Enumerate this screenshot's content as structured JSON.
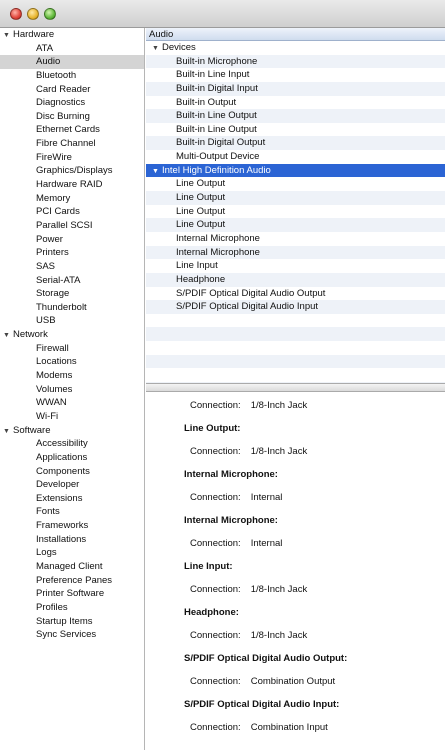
{
  "sidebar": {
    "groups": [
      {
        "label": "Hardware",
        "items": [
          "ATA",
          "Audio",
          "Bluetooth",
          "Card Reader",
          "Diagnostics",
          "Disc Burning",
          "Ethernet Cards",
          "Fibre Channel",
          "FireWire",
          "Graphics/Displays",
          "Hardware RAID",
          "Memory",
          "PCI Cards",
          "Parallel SCSI",
          "Power",
          "Printers",
          "SAS",
          "Serial-ATA",
          "Storage",
          "Thunderbolt",
          "USB"
        ]
      },
      {
        "label": "Network",
        "items": [
          "Firewall",
          "Locations",
          "Modems",
          "Volumes",
          "WWAN",
          "Wi-Fi"
        ]
      },
      {
        "label": "Software",
        "items": [
          "Accessibility",
          "Applications",
          "Components",
          "Developer",
          "Extensions",
          "Fonts",
          "Frameworks",
          "Installations",
          "Logs",
          "Managed Client",
          "Preference Panes",
          "Printer Software",
          "Profiles",
          "Startup Items",
          "Sync Services"
        ]
      }
    ],
    "selected": "Audio"
  },
  "list": {
    "header": "Audio",
    "groups": [
      {
        "label": "Devices",
        "items": [
          "Built-in Microphone",
          "Built-in Line Input",
          "Built-in Digital Input",
          "Built-in Output",
          "Built-in Line Output",
          "Built-in Line Output",
          "Built-in Digital Output",
          "Multi-Output Device"
        ]
      },
      {
        "label": "Intel High Definition Audio",
        "items": [
          "Line Output",
          "Line Output",
          "Line Output",
          "Line Output",
          "Internal Microphone",
          "Internal Microphone",
          "Line Input",
          "Headphone",
          "S/PDIF Optical Digital Audio Output",
          "S/PDIF Optical Digital Audio Input"
        ]
      }
    ],
    "highlighted_group": "Intel High Definition Audio"
  },
  "detail": {
    "connection_key": "Connection:",
    "top_connection": "1/8-Inch Jack",
    "sections": [
      {
        "title": "Line Output:",
        "connection": "1/8-Inch Jack"
      },
      {
        "title": "Internal Microphone:",
        "connection": "Internal"
      },
      {
        "title": "Internal Microphone:",
        "connection": "Internal"
      },
      {
        "title": "Line Input:",
        "connection": "1/8-Inch Jack"
      },
      {
        "title": "Headphone:",
        "connection": "1/8-Inch Jack"
      },
      {
        "title": "S/PDIF Optical Digital Audio Output:",
        "connection": "Combination Output"
      },
      {
        "title": "S/PDIF Optical Digital Audio Input:",
        "connection": "Combination Input"
      }
    ]
  }
}
